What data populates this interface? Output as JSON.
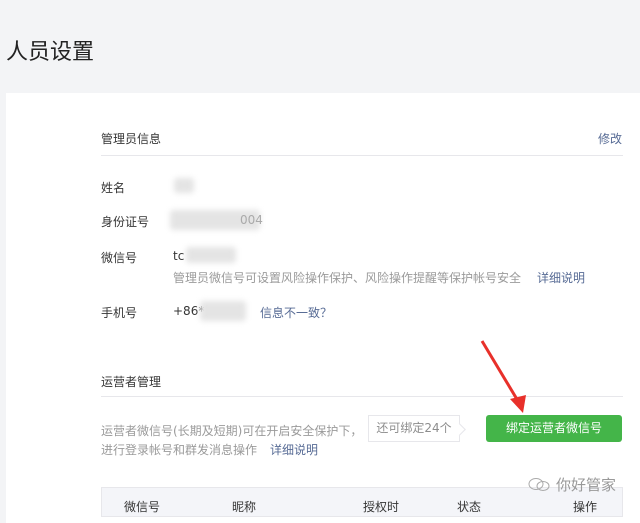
{
  "page_title": "人员设置",
  "admin": {
    "section_title": "管理员信息",
    "edit_link": "修改",
    "rows": {
      "name_label": "姓名",
      "id_label": "身份证号",
      "id_value_tail": "004",
      "wechat_label": "微信号",
      "wechat_value": "tc",
      "wechat_note": "管理员微信号可设置风险操作保护、风险操作提醒等保护帐号安全",
      "wechat_detail_link": "详细说明",
      "phone_label": "手机号",
      "phone_value": "+86*",
      "phone_mismatch_link": "信息不一致？"
    }
  },
  "operators": {
    "section_title": "运营者管理",
    "desc_line1": "运营者微信号(长期及短期)可在开启安全保护下，",
    "desc_line2": "进行登录帐号和群发消息操作",
    "detail_link": "详细说明",
    "remaining_tag": "还可绑定24个",
    "bind_button": "绑定运营者微信号",
    "table_headers": [
      "微信号",
      "昵称",
      "授权时",
      "状态",
      "操作"
    ]
  },
  "watermark": "你好管家",
  "colors": {
    "accent_green": "#44b549",
    "link_blue": "#576b95",
    "arrow_red": "#e8302a"
  }
}
